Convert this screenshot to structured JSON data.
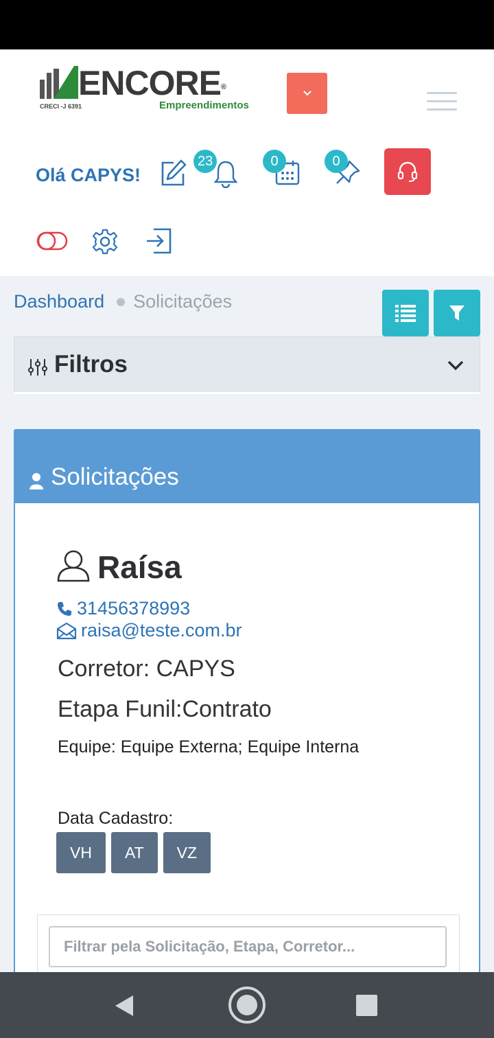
{
  "brand": {
    "name": "ENCORE",
    "registered_mark": "®",
    "subtitle": "Empreendimentos",
    "creci": "CRECI -J 6391",
    "green": "#2e8b3a"
  },
  "header": {
    "dropdown_icon": "chevron-down-icon",
    "menu_icon": "hamburger-menu-icon",
    "greeting": "Olá CAPYS!",
    "toolbar": [
      {
        "name": "edit-icon",
        "badge": ""
      },
      {
        "name": "bell-icon",
        "badge": "23"
      },
      {
        "name": "calendar-icon",
        "badge": "0"
      },
      {
        "name": "pin-icon",
        "badge": "0"
      },
      {
        "name": "headset-icon",
        "badge": ""
      }
    ],
    "toolbar2": [
      "toggle-icon",
      "gear-icon",
      "logout-icon"
    ]
  },
  "breadcrumb": {
    "home": "Dashboard",
    "current": "Solicitações"
  },
  "actions": {
    "list_icon": "list-icon",
    "filter_icon": "filter-icon"
  },
  "filters": {
    "title": "Filtros"
  },
  "card": {
    "title": "Solicitações",
    "person": {
      "name": "Raísa",
      "phone": "31456378993",
      "email": "raisa@teste.com.br",
      "corretor": "Corretor: CAPYS",
      "etapa": "Etapa Funil:Contrato",
      "equipe": "Equipe: Equipe Externa; Equipe Interna",
      "data_cadastro": "Data Cadastro:",
      "chips": [
        "VH",
        "AT",
        "VZ"
      ]
    },
    "search_placeholder": "Filtrar pela Solicitação, Etapa, Corretor..."
  },
  "colors": {
    "primary": "#2f74b5",
    "teal": "#2bb9c9",
    "card_header": "#5b9bd5",
    "danger": "#e8484f",
    "coral": "#f26b5b",
    "chip": "#5a6f86"
  }
}
